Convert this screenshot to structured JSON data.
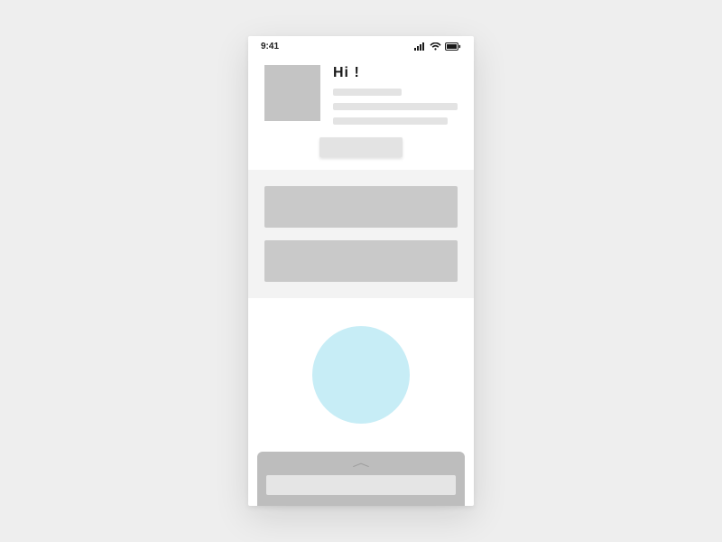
{
  "status": {
    "time": "9:41",
    "signal_icon": "signal-icon",
    "wifi_icon": "wifi-icon",
    "battery_icon": "battery-icon"
  },
  "hero": {
    "greeting": "Hi !",
    "avatar": "avatar-placeholder",
    "line1": "",
    "line2": "",
    "line3": "",
    "cta_label": ""
  },
  "cards": [
    {
      "label": ""
    },
    {
      "label": ""
    }
  ],
  "feature": {
    "circle_color": "#c7edf6"
  },
  "sheet": {
    "handle": "chevron-up-icon",
    "row_label": ""
  }
}
